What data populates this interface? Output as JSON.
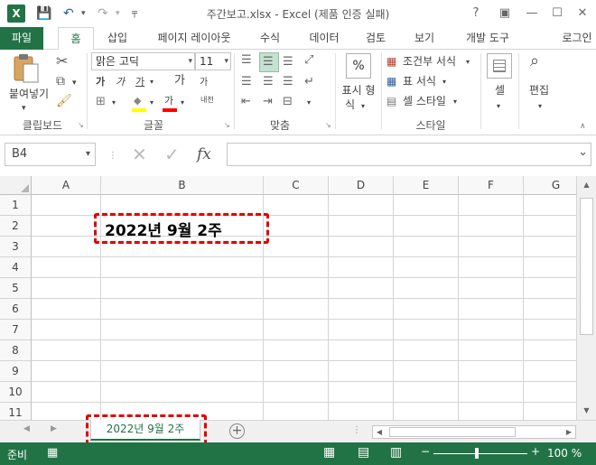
{
  "window": {
    "title": "주간보고.xlsx - Excel (제품 인증 실패)",
    "help": "?",
    "minimize": "—",
    "maximize": "☐",
    "close": "✕"
  },
  "quick_access": {
    "app_icon": "X",
    "save": "💾",
    "undo": "↶",
    "redo": "↷",
    "customize": "╤"
  },
  "tabs": [
    "파일",
    "홈",
    "삽입",
    "페이지 레이아웃",
    "수식",
    "데이터",
    "검토",
    "보기",
    "개발 도구"
  ],
  "signin": "로그인",
  "ribbon": {
    "clipboard": {
      "paste": "붙여넣기",
      "group": "클립보드"
    },
    "font": {
      "name": "맑은 고딕",
      "size": "11",
      "bold": "가",
      "italic": "가",
      "underline": "가",
      "grow": "가",
      "shrink": "가",
      "fill": "◆",
      "color": "가",
      "phonetic": "내천",
      "group": "글꼴"
    },
    "alignment": {
      "group": "맞춤"
    },
    "number": {
      "button_icon": "%",
      "button_line1": "표시 형",
      "button_line2": "식",
      "group": ""
    },
    "styles": {
      "conditional": "조건부 서식",
      "table": "표 서식",
      "cell": "셀 스타일",
      "group": "스타일"
    },
    "cells": {
      "label": "셀"
    },
    "editing": {
      "label": "편집"
    }
  },
  "formula_bar": {
    "name_box": "B4",
    "fx": "fx",
    "value": ""
  },
  "grid": {
    "columns": [
      "A",
      "B",
      "C",
      "D",
      "E",
      "F",
      "G"
    ],
    "rows": [
      "1",
      "2",
      "3",
      "4",
      "5",
      "6",
      "7",
      "8",
      "9",
      "10",
      "11"
    ],
    "selected_column": "B",
    "b2_value": "2022년 9월 2주"
  },
  "sheets": {
    "active": "2022년 9월 2주",
    "add": "+"
  },
  "status": {
    "mode": "준비",
    "zoom": "100 %"
  },
  "colors": {
    "excel_green": "#217346",
    "annotation_red": "#e00000"
  }
}
